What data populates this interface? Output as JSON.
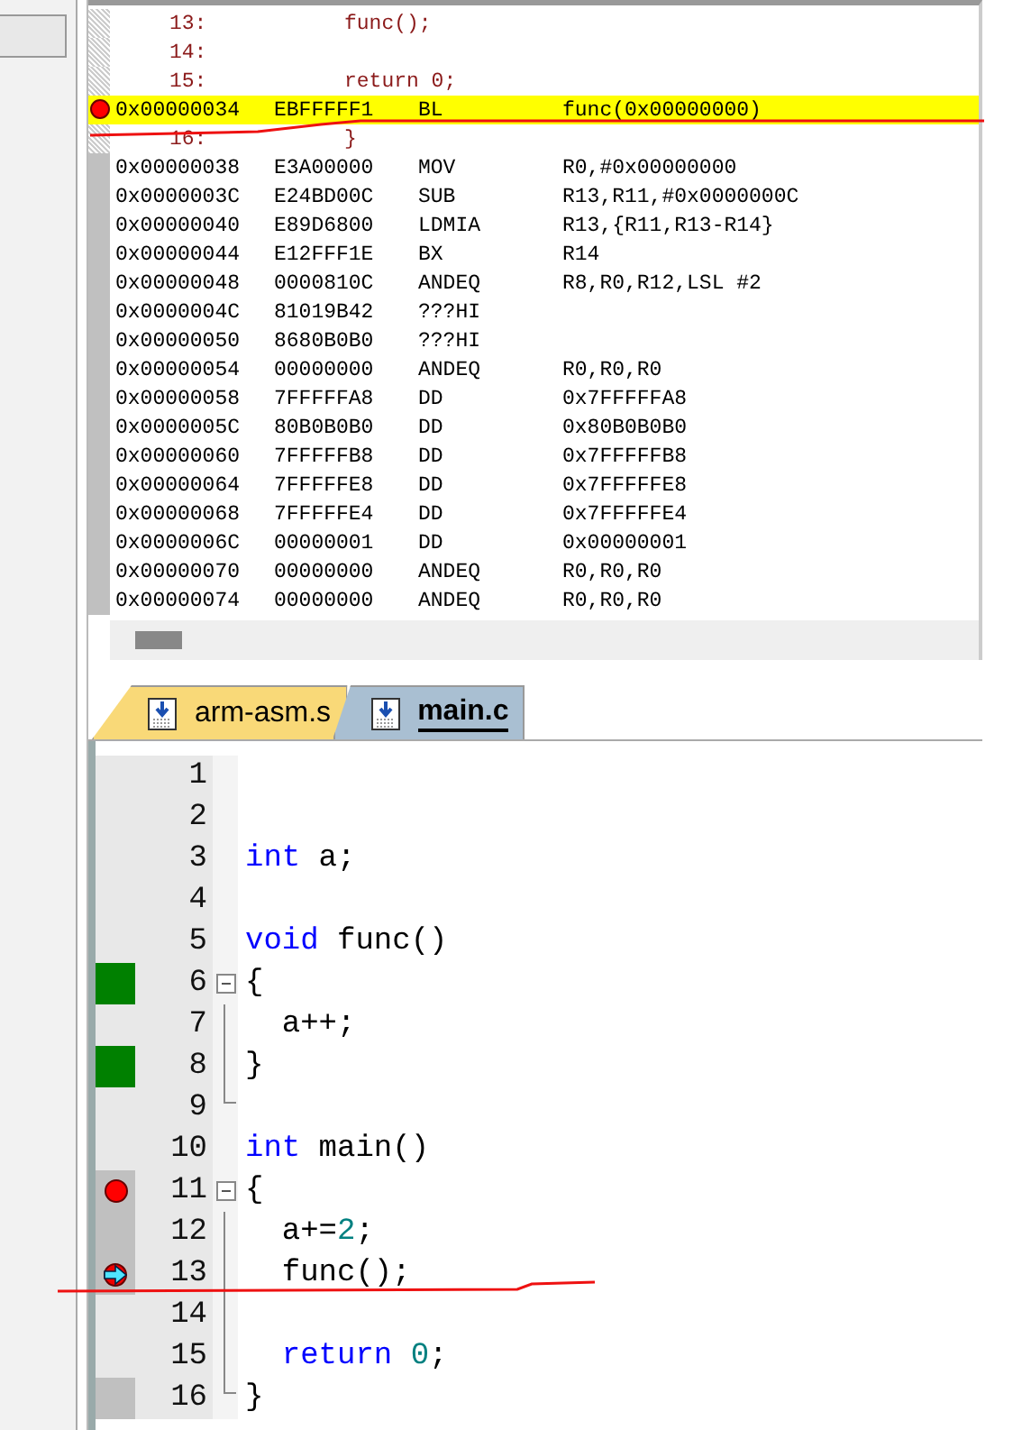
{
  "disassembly": {
    "rows": [
      {
        "kind": "source",
        "line": "13:",
        "code": "func();",
        "breakpoint": false,
        "highlighted": false
      },
      {
        "kind": "source",
        "line": "14:",
        "breakpoint": false,
        "highlighted": false
      },
      {
        "kind": "source",
        "line": "15:",
        "code": "return 0;",
        "breakpoint": false,
        "highlighted": false
      },
      {
        "kind": "asm",
        "address": "0x00000034",
        "opcode": "EBFFFFF1",
        "mnemonic": "BL",
        "operands": "func(0x00000000)",
        "breakpoint": true,
        "highlighted": true
      },
      {
        "kind": "source",
        "line": "16:",
        "code": "}",
        "breakpoint": false,
        "highlighted": false
      },
      {
        "kind": "asm",
        "address": "0x00000038",
        "opcode": "E3A00000",
        "mnemonic": "MOV",
        "operands": "R0,#0x00000000",
        "breakpoint": false,
        "highlighted": false
      },
      {
        "kind": "asm",
        "address": "0x0000003C",
        "opcode": "E24BD00C",
        "mnemonic": "SUB",
        "operands": "R13,R11,#0x0000000C",
        "breakpoint": false,
        "highlighted": false
      },
      {
        "kind": "asm",
        "address": "0x00000040",
        "opcode": "E89D6800",
        "mnemonic": "LDMIA",
        "operands": "R13,{R11,R13-R14}",
        "breakpoint": false,
        "highlighted": false
      },
      {
        "kind": "asm",
        "address": "0x00000044",
        "opcode": "E12FFF1E",
        "mnemonic": "BX",
        "operands": "R14",
        "breakpoint": false,
        "highlighted": false
      },
      {
        "kind": "asm",
        "address": "0x00000048",
        "opcode": "0000810C",
        "mnemonic": "ANDEQ",
        "operands": "R8,R0,R12,LSL #2",
        "breakpoint": false,
        "highlighted": false
      },
      {
        "kind": "asm",
        "address": "0x0000004C",
        "opcode": "81019B42",
        "mnemonic": "???HI",
        "breakpoint": false,
        "highlighted": false
      },
      {
        "kind": "asm",
        "address": "0x00000050",
        "opcode": "8680B0B0",
        "mnemonic": "???HI",
        "breakpoint": false,
        "highlighted": false
      },
      {
        "kind": "asm",
        "address": "0x00000054",
        "opcode": "00000000",
        "mnemonic": "ANDEQ",
        "operands": "R0,R0,R0",
        "breakpoint": false,
        "highlighted": false
      },
      {
        "kind": "asm",
        "address": "0x00000058",
        "opcode": "7FFFFFA8",
        "mnemonic": "DD",
        "operands": "0x7FFFFFA8",
        "breakpoint": false,
        "highlighted": false
      },
      {
        "kind": "asm",
        "address": "0x0000005C",
        "opcode": "80B0B0B0",
        "mnemonic": "DD",
        "operands": "0x80B0B0B0",
        "breakpoint": false,
        "highlighted": false
      },
      {
        "kind": "asm",
        "address": "0x00000060",
        "opcode": "7FFFFFB8",
        "mnemonic": "DD",
        "operands": "0x7FFFFFB8",
        "breakpoint": false,
        "highlighted": false
      },
      {
        "kind": "asm",
        "address": "0x00000064",
        "opcode": "7FFFFFE8",
        "mnemonic": "DD",
        "operands": "0x7FFFFFE8",
        "breakpoint": false,
        "highlighted": false
      },
      {
        "kind": "asm",
        "address": "0x00000068",
        "opcode": "7FFFFFE4",
        "mnemonic": "DD",
        "operands": "0x7FFFFFE4",
        "breakpoint": false,
        "highlighted": false
      },
      {
        "kind": "asm",
        "address": "0x0000006C",
        "opcode": "00000001",
        "mnemonic": "DD",
        "operands": "0x00000001",
        "breakpoint": false,
        "highlighted": false
      },
      {
        "kind": "asm",
        "address": "0x00000070",
        "opcode": "00000000",
        "mnemonic": "ANDEQ",
        "operands": "R0,R0,R0",
        "breakpoint": false,
        "highlighted": false
      },
      {
        "kind": "asm",
        "address": "0x00000074",
        "opcode": "00000000",
        "mnemonic": "ANDEQ",
        "operands": "R0,R0,R0",
        "breakpoint": false,
        "highlighted": false
      }
    ]
  },
  "tabs": [
    {
      "label": "arm-asm.s",
      "selected": false
    },
    {
      "label": "main.c",
      "selected": true
    }
  ],
  "editor": {
    "lines": [
      {
        "number": "1",
        "executed": false,
        "covered": false,
        "breakpoint": false,
        "current": false,
        "fold_start": false,
        "in_fold": false,
        "fold_end": false
      },
      {
        "number": "2",
        "executed": false,
        "covered": false,
        "breakpoint": false,
        "current": false,
        "fold_start": false,
        "in_fold": false,
        "fold_end": false
      },
      {
        "number": "3",
        "executed": false,
        "covered": false,
        "breakpoint": false,
        "current": false,
        "fold_start": false,
        "in_fold": false,
        "fold_end": false,
        "tokens": [
          {
            "kind": "keyword",
            "text": "int"
          },
          {
            "kind": "plain",
            "text": " a;"
          }
        ]
      },
      {
        "number": "4",
        "executed": false,
        "covered": false,
        "breakpoint": false,
        "current": false,
        "fold_start": false,
        "in_fold": false,
        "fold_end": false
      },
      {
        "number": "5",
        "executed": false,
        "covered": false,
        "breakpoint": false,
        "current": false,
        "fold_start": false,
        "in_fold": false,
        "fold_end": false,
        "tokens": [
          {
            "kind": "keyword",
            "text": "void"
          },
          {
            "kind": "plain",
            "text": " func()"
          }
        ]
      },
      {
        "number": "6",
        "executed": true,
        "covered": false,
        "breakpoint": false,
        "current": false,
        "fold_start": true,
        "in_fold": false,
        "fold_end": false,
        "tokens": [
          {
            "kind": "plain",
            "text": "{"
          }
        ]
      },
      {
        "number": "7",
        "executed": false,
        "covered": false,
        "breakpoint": false,
        "current": false,
        "fold_start": false,
        "in_fold": true,
        "fold_end": false,
        "tokens": [
          {
            "kind": "plain",
            "text": "  a++;"
          }
        ]
      },
      {
        "number": "8",
        "executed": true,
        "covered": false,
        "breakpoint": false,
        "current": false,
        "fold_start": false,
        "in_fold": true,
        "fold_end": false,
        "tokens": [
          {
            "kind": "plain",
            "text": "}"
          }
        ]
      },
      {
        "number": "9",
        "executed": false,
        "covered": false,
        "breakpoint": false,
        "current": false,
        "fold_start": false,
        "in_fold": false,
        "fold_end": true
      },
      {
        "number": "10",
        "executed": false,
        "covered": false,
        "breakpoint": false,
        "current": false,
        "fold_start": false,
        "in_fold": false,
        "fold_end": false,
        "tokens": [
          {
            "kind": "keyword",
            "text": "int"
          },
          {
            "kind": "plain",
            "text": " main()"
          }
        ]
      },
      {
        "number": "11",
        "executed": false,
        "covered": true,
        "breakpoint": true,
        "current": false,
        "fold_start": true,
        "in_fold": false,
        "fold_end": false,
        "tokens": [
          {
            "kind": "plain",
            "text": "{"
          }
        ]
      },
      {
        "number": "12",
        "executed": false,
        "covered": true,
        "breakpoint": false,
        "current": false,
        "fold_start": false,
        "in_fold": true,
        "fold_end": false,
        "tokens": [
          {
            "kind": "plain",
            "text": "  a+="
          },
          {
            "kind": "number",
            "text": "2"
          },
          {
            "kind": "plain",
            "text": ";"
          }
        ]
      },
      {
        "number": "13",
        "executed": false,
        "covered": true,
        "breakpoint": true,
        "current": true,
        "fold_start": false,
        "in_fold": true,
        "fold_end": false,
        "tokens": [
          {
            "kind": "plain",
            "text": "  func();"
          }
        ]
      },
      {
        "number": "14",
        "executed": false,
        "covered": false,
        "breakpoint": false,
        "current": false,
        "fold_start": false,
        "in_fold": true,
        "fold_end": false
      },
      {
        "number": "15",
        "executed": false,
        "covered": false,
        "breakpoint": false,
        "current": false,
        "fold_start": false,
        "in_fold": true,
        "fold_end": false,
        "tokens": [
          {
            "kind": "keyword",
            "text": "  return "
          },
          {
            "kind": "number",
            "text": "0"
          },
          {
            "kind": "plain",
            "text": ";"
          }
        ]
      },
      {
        "number": "16",
        "executed": false,
        "covered": true,
        "breakpoint": false,
        "current": false,
        "fold_start": false,
        "in_fold": false,
        "fold_end": true,
        "tokens": [
          {
            "kind": "plain",
            "text": "}"
          }
        ]
      }
    ]
  }
}
